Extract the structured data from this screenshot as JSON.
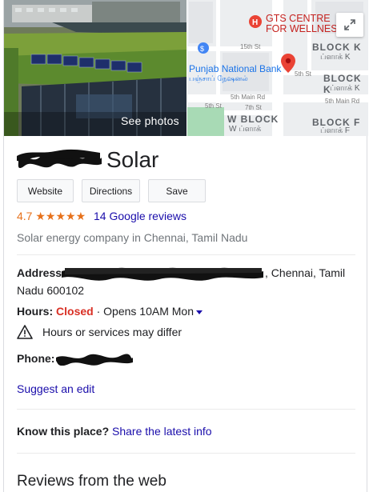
{
  "header": {
    "see_photos_label": "See photos",
    "map_labels": {
      "gts_centre_line1": "GTS CENTRE",
      "gts_centre_line2": "FOR WELLNESS",
      "block_k": "BLOCK K",
      "block_k_tamil": "ப்ளாக் K",
      "punjab_bank": "Punjab National Bank",
      "punjab_tamil": "பஞ்சாப் நேஷனல்",
      "st_15": "15th St",
      "st_5": "5th St",
      "main_rd_5": "5th Main Rd",
      "st_7": "7th St",
      "st_5b": "5th St",
      "w_block": "W BLOCK",
      "w_block_tamil": "W ப்ளாக்",
      "block_f": "BLOCK F",
      "block_f_tamil": "ப்ளாக் F"
    }
  },
  "business": {
    "name_visible": "Solar",
    "rating_score": "4.7",
    "stars": "★★★★★",
    "reviews_link": "14 Google reviews",
    "category": "Solar energy company in Chennai, Tamil Nadu"
  },
  "actions": {
    "website": "Website",
    "directions": "Directions",
    "save": "Save"
  },
  "info": {
    "address_label": "Address",
    "address_tail": ", Chennai, Tamil Nadu 600102",
    "hours_label": "Hours:",
    "hours_status": "Closed",
    "hours_next": "· Opens 10AM Mon",
    "warning_text": "Hours or services may differ",
    "phone_label": "Phone:"
  },
  "links": {
    "suggest_edit": "Suggest an edit",
    "know_label": "Know this place?",
    "know_link": "Share the latest info"
  },
  "sections": {
    "reviews_from_web": "Reviews from the web"
  },
  "colors": {
    "accent_link": "#1a0dab",
    "star_orange": "#e7711b",
    "closed_red": "#d93025",
    "map_pin": "#ea4335"
  }
}
